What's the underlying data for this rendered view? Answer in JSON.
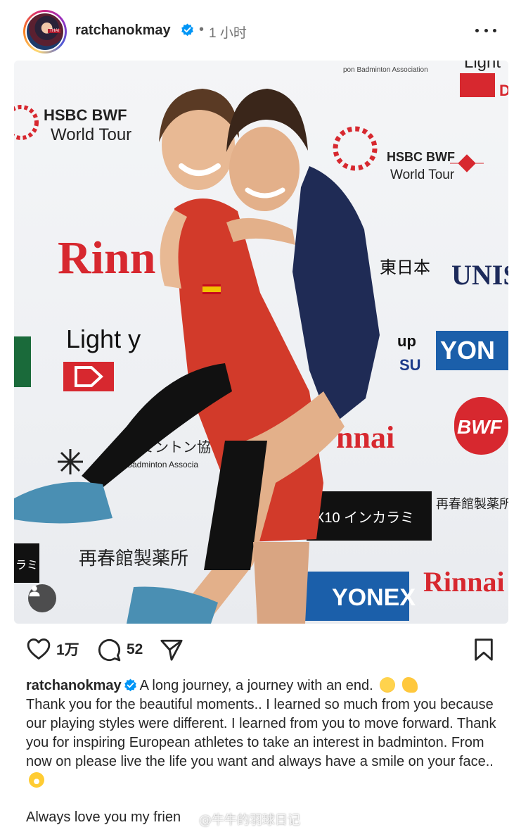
{
  "post": {
    "username": "ratchanokmay",
    "separator": "•",
    "time": "1 小时",
    "more_label": "•••"
  },
  "photo": {
    "banner_texts": {
      "hsbc_left_1": "HSBC BWF",
      "hsbc_left_2": "World Tour",
      "hsbc_right_1": "HSBC BWF",
      "hsbc_right_2": "World Tour",
      "association_top": "pon Badminton Association",
      "rinnai_left": "Rinn",
      "rinnai_bottom": "Rinnai",
      "light_left": "Light y",
      "light_top": "Light",
      "east_japan": "東日本",
      "unis": "UNIS",
      "yonex_right": "YON",
      "yonex_bottom": "YONEX",
      "bwf": "BWF",
      "badminton_jp": "ドミントン協",
      "badminton_en": "Badminton Associa",
      "seishunkan_left": "再春館製薬所",
      "seishunkan_right": "再春館製薬所",
      "camera": "X10 インカラミ",
      "nnai": "nnai",
      "up": "up",
      "su": "SU",
      "rami": "ラミ"
    },
    "user_tag_icon": "person-icon"
  },
  "actions": {
    "likes": "1万",
    "comments": "52"
  },
  "caption": {
    "username": "ratchanokmay",
    "first_line": "A long journey, a journey with an end.",
    "body": "Thank you for the beautiful moments.. I learned so much from you because our playing styles were different. I learned from you to move forward. Thank you for inspiring European athletes to take an interest in badminton. From now on please live the life you want and always have a smile on your face..",
    "last_line": "Always love you my frien",
    "watermark": "@牛牛的羽球日记"
  },
  "colors": {
    "verified": "#0095f6",
    "text": "#262626",
    "muted": "#737373",
    "bwf_red": "#d7282f",
    "yonex_blue": "#1b5faa"
  }
}
